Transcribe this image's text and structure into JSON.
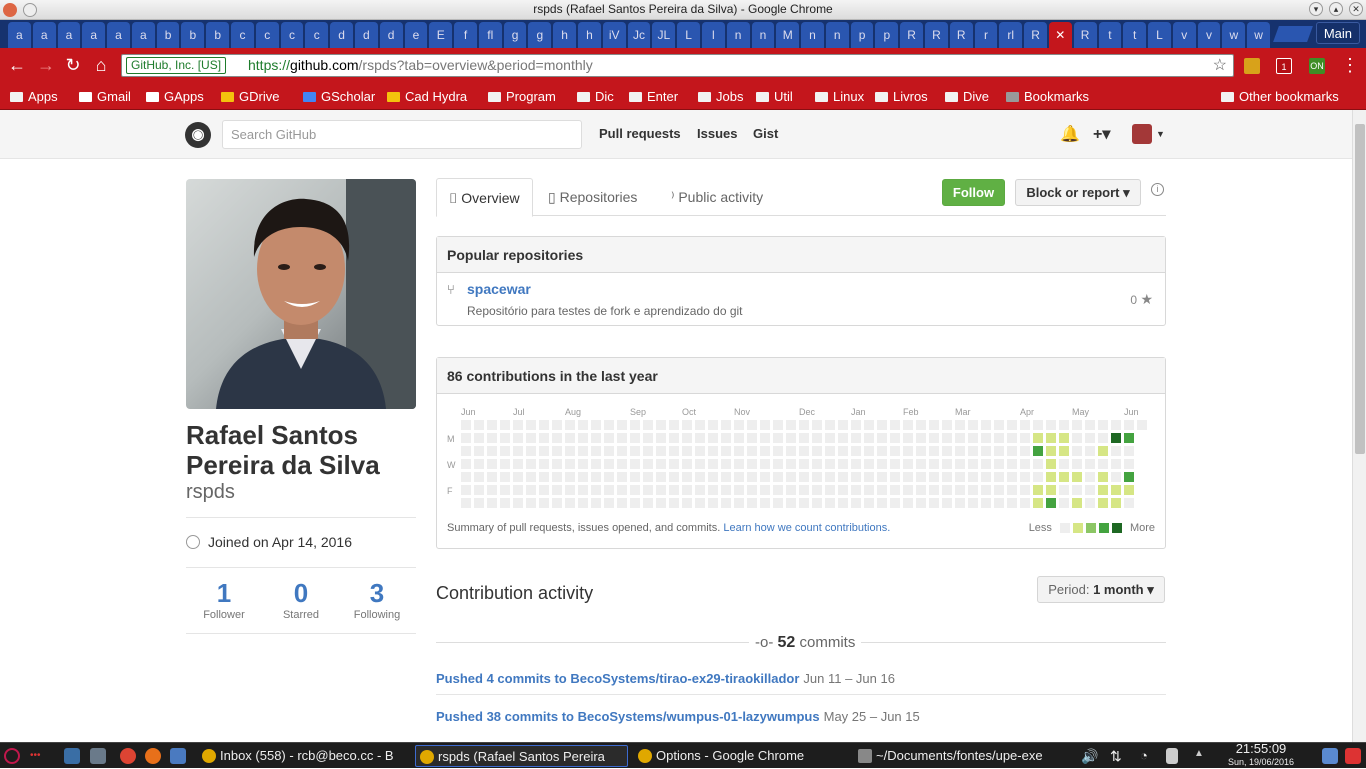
{
  "window": {
    "title": "rspds (Rafael Santos Pereira da Silva) - Google Chrome"
  },
  "tabs": [
    "a",
    "a",
    "a",
    "a",
    "a",
    "a",
    "b",
    "b",
    "b",
    "c",
    "c",
    "c",
    "c",
    "d",
    "d",
    "d",
    "e",
    "E",
    "f",
    "fl",
    "g",
    "g",
    "h",
    "h",
    "iV",
    "Jc",
    "JL",
    "L",
    "l",
    "n",
    "n",
    "M",
    "n",
    "n",
    "p",
    "p",
    "R",
    "R",
    "R",
    "r",
    "rl",
    "R",
    "✕",
    "R",
    "t",
    "t",
    "L",
    "v",
    "v",
    "w",
    "w"
  ],
  "active_tab_index": 42,
  "main_button": "Main",
  "browser": {
    "security_label": "GitHub, Inc. [US]",
    "url_scheme": "https://",
    "url_host": "github.com",
    "url_path": "/rspds?tab=overview&period=monthly",
    "ext_badge_1": "1",
    "ext_badge_2": "ON"
  },
  "bookmarks": [
    "Apps",
    "Gmail",
    "GApps",
    "GDrive",
    "GScholar",
    "Cad Hydra",
    "Program",
    "Dic",
    "Enter",
    "Jobs",
    "Util",
    "Linux",
    "Livros",
    "Dive",
    "Bookmarks"
  ],
  "other_bookmarks": "Other bookmarks",
  "github_header": {
    "search_placeholder": "Search GitHub",
    "nav": [
      "Pull requests",
      "Issues",
      "Gist"
    ],
    "plus": "+▾"
  },
  "profile": {
    "name": "Rafael Santos Pereira da Silva",
    "login": "rspds",
    "joined": "Joined on Apr 14, 2016",
    "stats": [
      {
        "n": "1",
        "label": "Follower"
      },
      {
        "n": "0",
        "label": "Starred"
      },
      {
        "n": "3",
        "label": "Following"
      }
    ]
  },
  "profile_tabs": [
    "Overview",
    "Repositories",
    "Public activity"
  ],
  "actions": {
    "follow": "Follow",
    "block": "Block or report ▾"
  },
  "popular": {
    "heading": "Popular repositories",
    "repo_name": "spacewar",
    "repo_desc": "Repositório para testes de fork e aprendizado do git",
    "stars": "0"
  },
  "contributions": {
    "heading": "86 contributions in the last year",
    "months": [
      "Jun",
      "Jul",
      "Aug",
      "Sep",
      "Oct",
      "Nov",
      "Dec",
      "Jan",
      "Feb",
      "Mar",
      "Apr",
      "May",
      "Jun"
    ],
    "days": [
      "M",
      "W",
      "F"
    ],
    "summary": "Summary of pull requests, issues opened, and commits.",
    "learn": "Learn how we count contributions.",
    "less": "Less",
    "more": "More",
    "colors": [
      "#eeeeee",
      "#d6e685",
      "#8cc665",
      "#44a340",
      "#1e6823"
    ],
    "active_cells": [
      [
        44,
        1,
        1
      ],
      [
        44,
        2,
        3
      ],
      [
        44,
        5,
        1
      ],
      [
        44,
        6,
        1
      ],
      [
        44,
        7,
        1
      ],
      [
        45,
        1,
        1
      ],
      [
        45,
        2,
        1
      ],
      [
        45,
        3,
        1
      ],
      [
        45,
        4,
        1
      ],
      [
        45,
        5,
        1
      ],
      [
        45,
        6,
        3
      ],
      [
        46,
        1,
        1
      ],
      [
        46,
        2,
        1
      ],
      [
        46,
        4,
        1
      ],
      [
        47,
        4,
        1
      ],
      [
        47,
        6,
        1
      ],
      [
        48,
        7,
        1
      ],
      [
        49,
        2,
        1
      ],
      [
        49,
        4,
        1
      ],
      [
        49,
        5,
        1
      ],
      [
        49,
        6,
        1
      ],
      [
        49,
        7,
        1
      ],
      [
        50,
        1,
        4
      ],
      [
        50,
        5,
        1
      ],
      [
        50,
        6,
        1
      ],
      [
        50,
        7,
        1
      ],
      [
        51,
        1,
        3
      ],
      [
        51,
        4,
        3
      ],
      [
        51,
        5,
        1
      ]
    ]
  },
  "activity": {
    "heading": "Contribution activity",
    "period_label": "Period:",
    "period_value": "1 month ▾",
    "commits_count": "52",
    "commits_word": "commits",
    "pushes": [
      {
        "text": "Pushed 4 commits to BecoSystems/tirao-ex29-tiraokillador",
        "date": "Jun 11 – Jun 16"
      },
      {
        "text": "Pushed 38 commits to BecoSystems/wumpus-01-lazywumpus",
        "date": "May 25 – Jun 15"
      }
    ]
  },
  "taskbar": {
    "tasks": [
      "Inbox (558) - rcb@beco.cc - B",
      "rspds (Rafael Santos Pereira",
      "Options - Google Chrome",
      "~/Documents/fontes/upe-exe"
    ],
    "time": "21:55:09",
    "date": "Sun, 19/06/2016"
  }
}
